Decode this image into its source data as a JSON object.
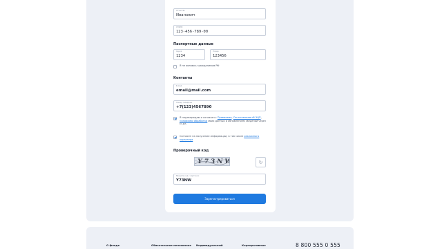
{
  "form": {
    "patronymic": {
      "label": "Отчество",
      "value": "Иванович"
    },
    "snils": {
      "label": "СНИЛС",
      "value": "123-456-789-00"
    },
    "passport_section": "Паспортные данные",
    "passport_series": {
      "label": "Серия",
      "value": "1234"
    },
    "passport_number": {
      "label": "Номер",
      "value": "123456"
    },
    "not_citizen_label": "Я не являюсь гражданином РФ",
    "contacts_section": "Контакты",
    "email": {
      "label": "E-mail",
      "value": "email@mail.com"
    },
    "phone": {
      "label": "Номер телефона",
      "value": "+7(123)4567890"
    },
    "consent1": {
      "prefix": "Я подтверждаю и согласен с ",
      "link1": "Правилами",
      "mid1": ", ",
      "link2": "Соглашением об ЭЦП",
      "mid2": ", ",
      "link3": "условиями обработки",
      "suffix": " моих данных и обновлением сведений через ЕСИА"
    },
    "consent2": {
      "prefix": "Согласен на получение информации, в том числе ",
      "link": "рекламного характера"
    },
    "captcha_section": "Проверочный код",
    "captcha_image_text": "Y73NW",
    "captcha_input": {
      "label": "Введите код с картинки",
      "value": "Y73NW"
    },
    "submit_label": "Зарегистрироваться"
  },
  "footer": {
    "columns": [
      "О фонде",
      "Обязательное пенсионное",
      "Индивидуальный",
      "Корпоративные"
    ],
    "phone": "8 800 555 0 555"
  },
  "colors": {
    "accent": "#1f7ae0",
    "panel": "#edf0f6"
  }
}
